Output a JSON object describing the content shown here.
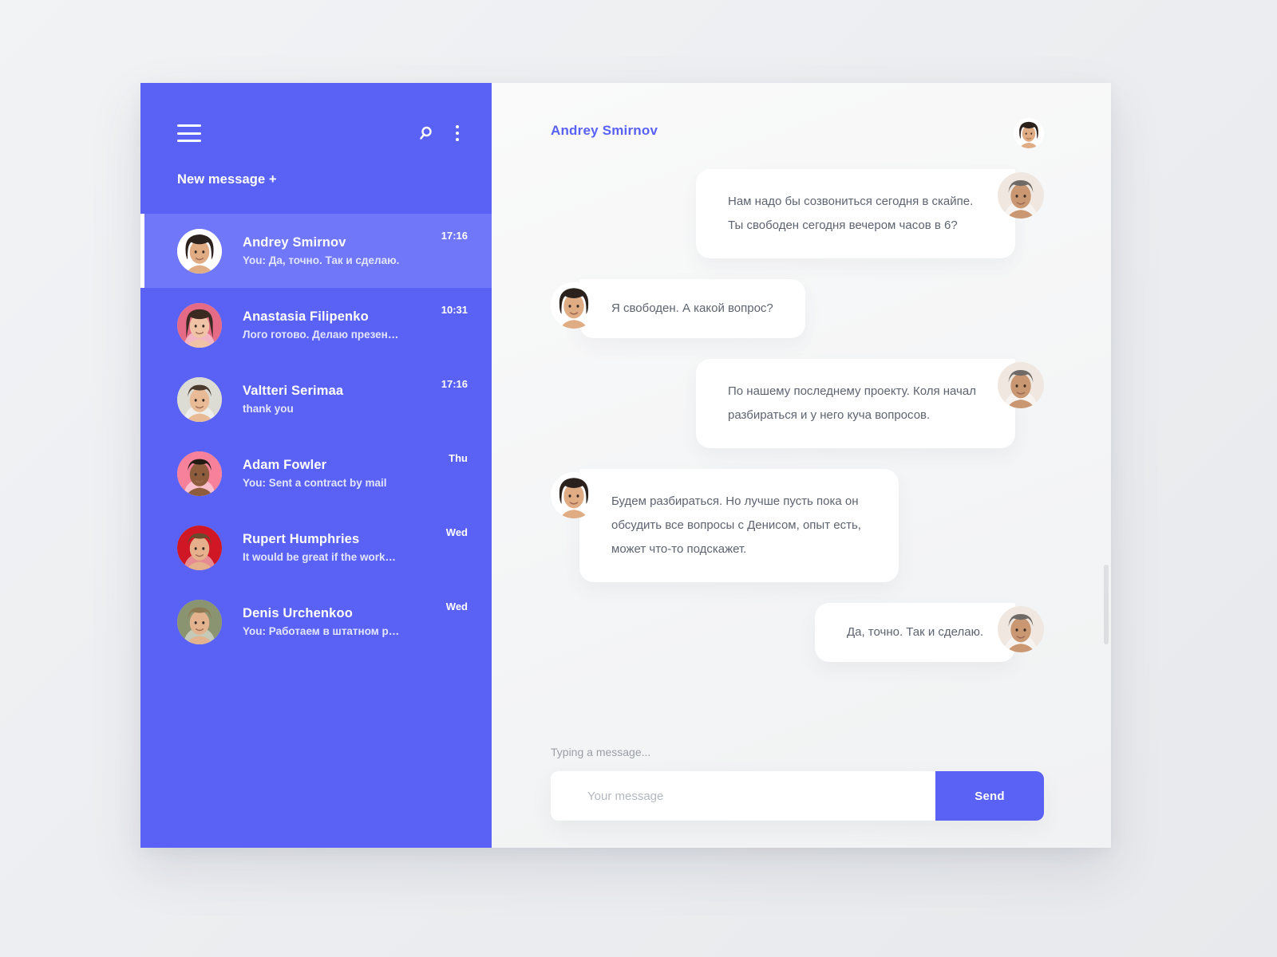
{
  "colors": {
    "sidebar_bg": "#5a62f5",
    "sidebar_active_bg": "#7077f8",
    "accent": "#5a62f5",
    "chat_bg": "#f5f6f7",
    "bubble_bg": "#ffffff",
    "bubble_text": "#5d6470"
  },
  "sidebar": {
    "menu_icon": "hamburger-menu-icon",
    "search_icon": "search-icon",
    "more_icon": "more-vertical-icon",
    "new_message_label": "New message +",
    "contacts": [
      {
        "name": "Andrey Smirnov",
        "preview": "You: Да, точно. Так и сделаю.",
        "time": "17:16",
        "active": true,
        "avatar": "andrey"
      },
      {
        "name": "Anastasia Filipenko",
        "preview": "Лого готово. Делаю презен…",
        "time": "10:31",
        "active": false,
        "avatar": "anastasia"
      },
      {
        "name": "Valtteri Serimaa",
        "preview": "thank you",
        "time": "17:16",
        "active": false,
        "avatar": "valtteri"
      },
      {
        "name": "Adam Fowler",
        "preview": "You: Sent a contract by mail",
        "time": "Thu",
        "active": false,
        "avatar": "adam"
      },
      {
        "name": "Rupert Humphries",
        "preview": "It would be great if the work…",
        "time": "Wed",
        "active": false,
        "avatar": "rupert"
      },
      {
        "name": "Denis Urchenkoo",
        "preview": "You: Работаем в штатном р…",
        "time": "Wed",
        "active": false,
        "avatar": "denis"
      }
    ]
  },
  "chat": {
    "title": "Andrey Smirnov",
    "header_avatar": "andrey",
    "messages": [
      {
        "side": "out",
        "text": "Нам надо бы созвониться сегодня в скайпе. Ты свободен сегодня вечером часов в 6?",
        "avatar": "you"
      },
      {
        "side": "in",
        "text": "Я свободен. А какой вопрос?",
        "avatar": "andrey"
      },
      {
        "side": "out",
        "text": "По нашему последнему проекту. Коля начал разбираться и у него куча вопросов.",
        "avatar": "you"
      },
      {
        "side": "in",
        "text": "Будем разбираться. Но лучше пусть пока он обсудить все вопросы с Денисом, опыт есть, может что-то подскажет.",
        "avatar": "andrey"
      },
      {
        "side": "out",
        "text": "Да, точно. Так и сделаю.",
        "avatar": "you"
      }
    ],
    "typing_status": "Typing a message...",
    "composer": {
      "placeholder": "Your message",
      "value": "",
      "send_label": "Send"
    }
  }
}
